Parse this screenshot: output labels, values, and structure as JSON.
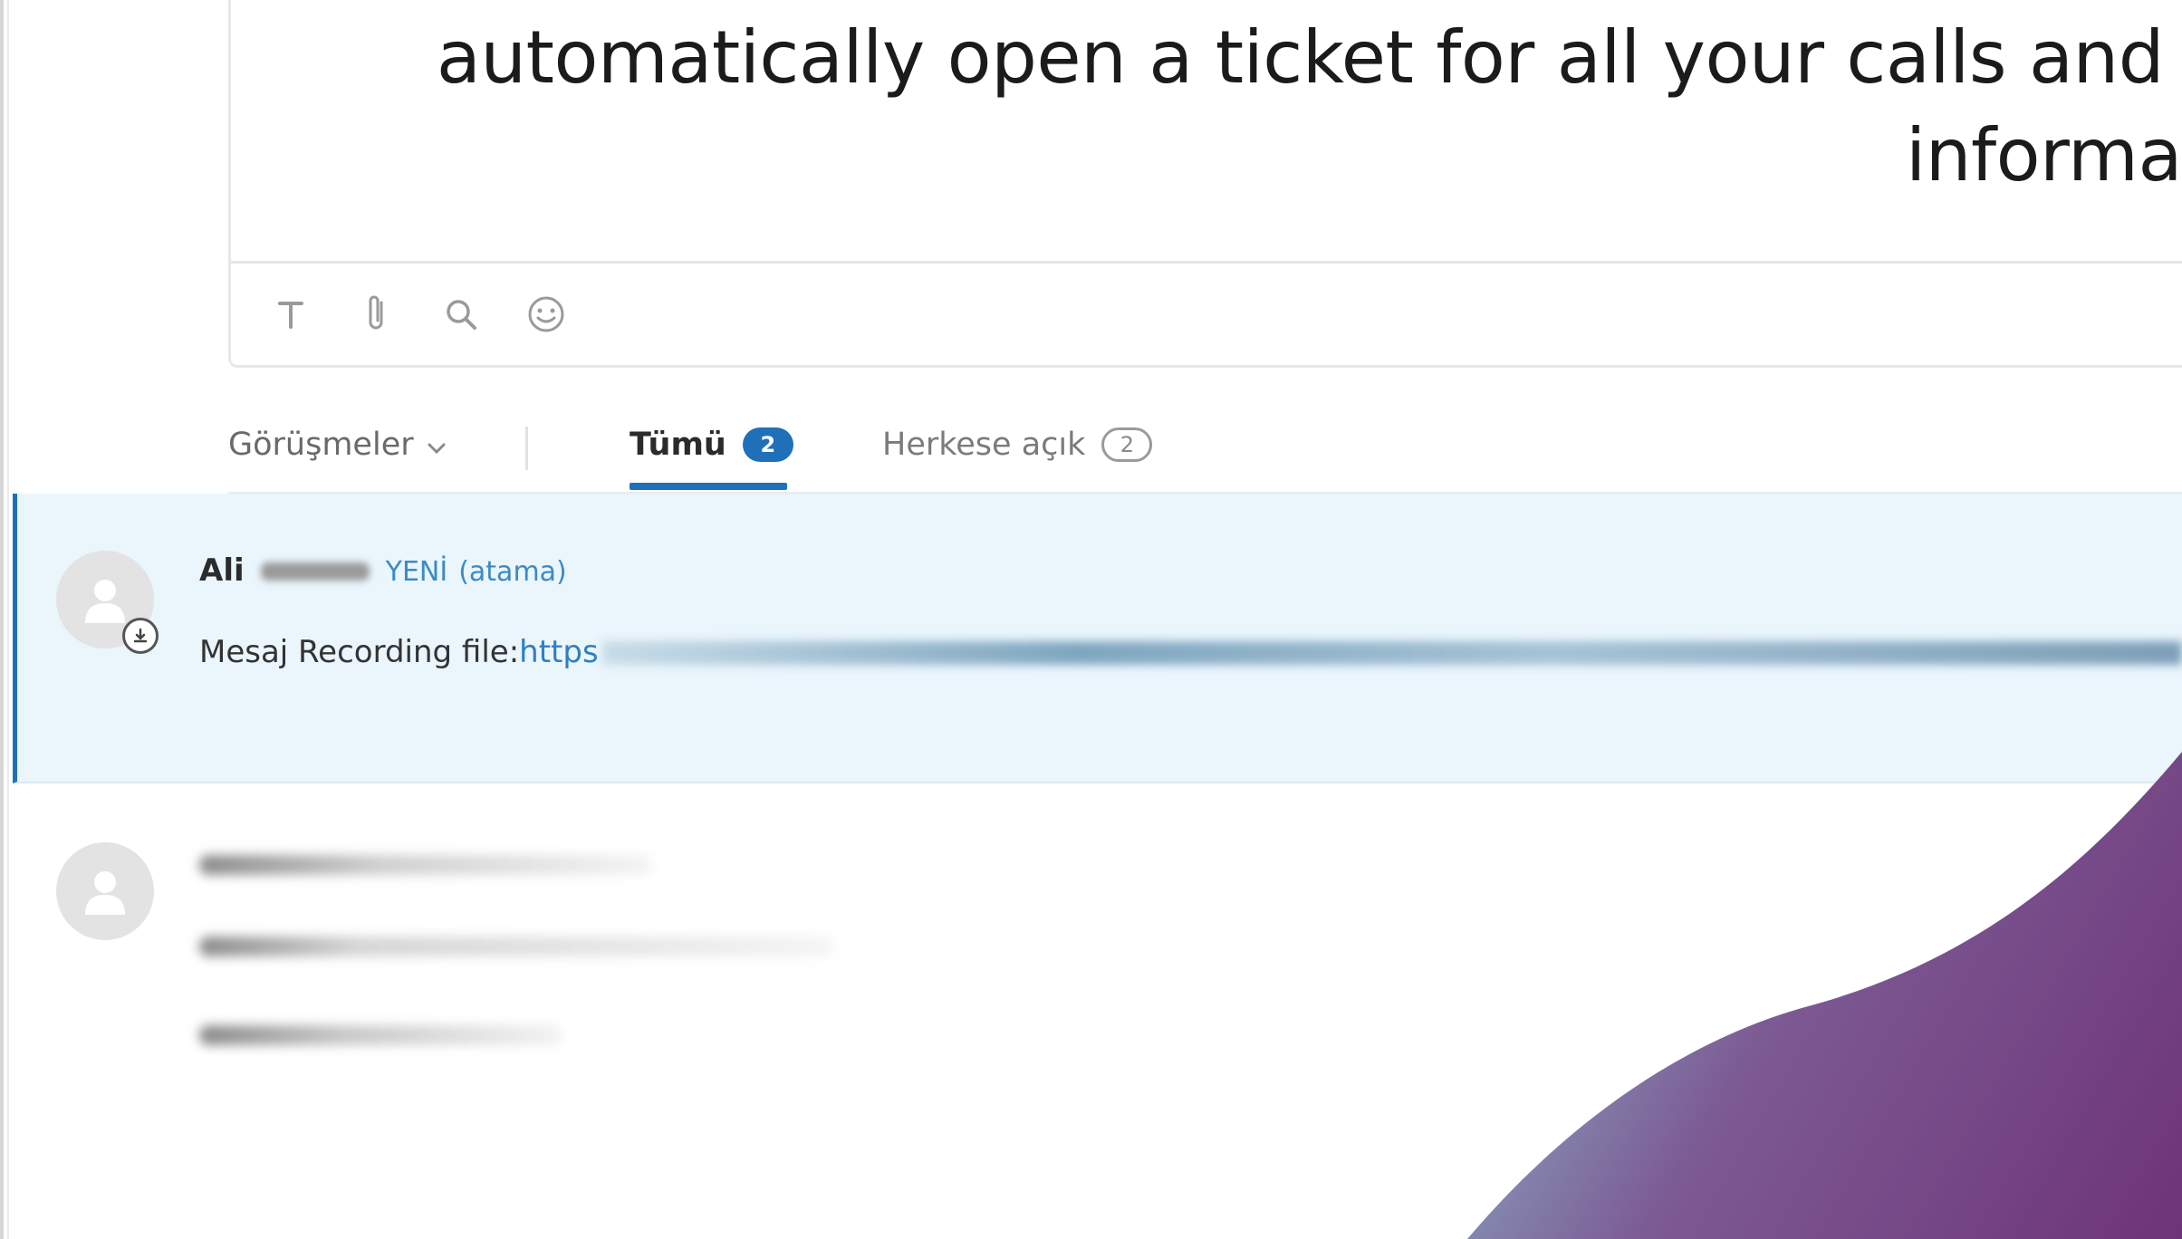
{
  "headline": {
    "line1": "automatically open a ticket for all your calls and",
    "line2": "informa"
  },
  "composer": {
    "tools": [
      {
        "name": "text-format-icon",
        "glyph": "T"
      },
      {
        "name": "attachment-icon",
        "glyph": "paperclip"
      },
      {
        "name": "search-icon",
        "glyph": "magnifier"
      },
      {
        "name": "emoji-icon",
        "glyph": "smiley"
      }
    ]
  },
  "tabs": {
    "dropdown_label": "Görüşmeler",
    "all_label": "Tümü",
    "all_count": "2",
    "public_label": "Herkese açık",
    "public_count": "2"
  },
  "conversations": [
    {
      "name": "Ali",
      "status": "YENİ",
      "assign": "(atama)",
      "message_label": "Mesaj Recording file:",
      "message_link": "https"
    }
  ],
  "colors": {
    "accent": "#1f70b8",
    "selected_row": "#eaf5fc",
    "deco_teal": "#8ec9d6",
    "deco_purple": "#6e3478"
  }
}
